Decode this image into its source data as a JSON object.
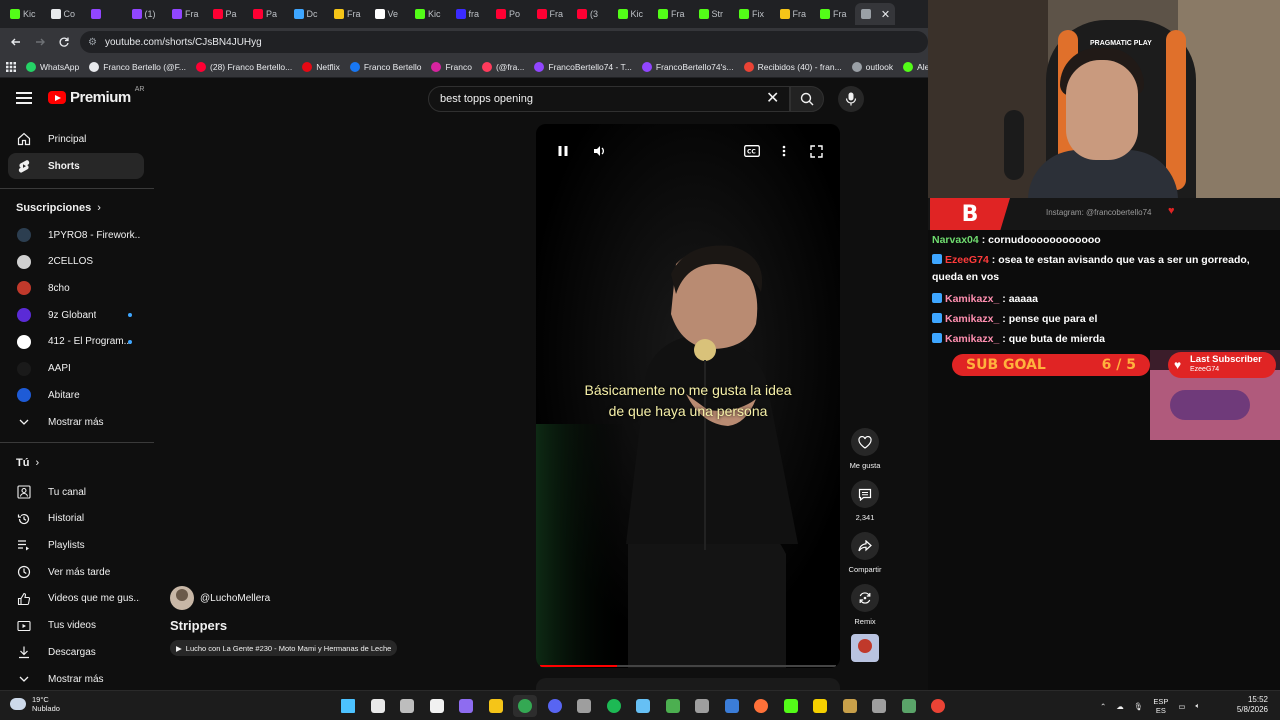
{
  "browser": {
    "tabs": [
      {
        "label": "Kic",
        "color": "#53fc18"
      },
      {
        "label": "Co",
        "color": "#e8eaed"
      },
      {
        "label": "",
        "color": "#9146ff"
      },
      {
        "label": "(1)",
        "color": "#9146ff"
      },
      {
        "label": "Fra",
        "color": "#9146ff"
      },
      {
        "label": "Pa",
        "color": "#ff0033"
      },
      {
        "label": "Pa",
        "color": "#ff0033"
      },
      {
        "label": "Dc",
        "color": "#3ea6ff"
      },
      {
        "label": "Fra",
        "color": "#f5c518"
      },
      {
        "label": "Ve",
        "color": "#ffffff"
      },
      {
        "label": "Kic",
        "color": "#53fc18"
      },
      {
        "label": "fra",
        "color": "#3b2bff"
      },
      {
        "label": "Po",
        "color": "#ff0033"
      },
      {
        "label": "Fra",
        "color": "#ff0033"
      },
      {
        "label": "(3",
        "color": "#ff0033"
      },
      {
        "label": "Kic",
        "color": "#53fc18"
      },
      {
        "label": "Fra",
        "color": "#53fc18"
      },
      {
        "label": "Str",
        "color": "#53fc18"
      },
      {
        "label": "Fix",
        "color": "#53fc18"
      },
      {
        "label": "Fra",
        "color": "#f5c518"
      },
      {
        "label": "Fra",
        "color": "#53fc18"
      },
      {
        "label": "",
        "color": "#9aa0a6"
      }
    ],
    "url": "youtube.com/shorts/CJsBN4JUHyg",
    "bookmarks": [
      {
        "label": "WhatsApp",
        "color": "#25d366"
      },
      {
        "label": "Franco Bertello (@F...",
        "color": "#e8eaed"
      },
      {
        "label": "(28) Franco Bertello...",
        "color": "#ff0033"
      },
      {
        "label": "Netflix",
        "color": "#e50914"
      },
      {
        "label": "Franco Bertello",
        "color": "#1877f2"
      },
      {
        "label": "Franco",
        "color": "#d6249f"
      },
      {
        "label": "(@fra...",
        "color": "#ff3b5c"
      },
      {
        "label": "FrancoBertello74 - T...",
        "color": "#9146ff"
      },
      {
        "label": "FrancoBertello74's...",
        "color": "#9146ff"
      },
      {
        "label": "Recibidos (40) - fran...",
        "color": "#ea4335"
      },
      {
        "label": "outlook",
        "color": "#9aa0a6"
      },
      {
        "label": "Alert",
        "color": "#53fc18"
      }
    ]
  },
  "youtube": {
    "logo_text": "Premium",
    "country_code": "AR",
    "search_query": "best topps opening",
    "sidebar": {
      "main": [
        {
          "label": "Principal",
          "icon": "home-icon"
        },
        {
          "label": "Shorts",
          "icon": "shorts-icon"
        }
      ],
      "subscriptions_header": "Suscripciones",
      "subscriptions": [
        {
          "label": "1PYRO8 - Firework...",
          "color": "#2c3e50",
          "new": false
        },
        {
          "label": "2CELLOS",
          "color": "#d0d0d0",
          "new": false
        },
        {
          "label": "8cho",
          "color": "#c0392b",
          "new": false
        },
        {
          "label": "9z Globant",
          "color": "#5b2bd6",
          "new": true
        },
        {
          "label": "412 - El Program...",
          "color": "#ffffff",
          "new": true
        },
        {
          "label": "AAPI",
          "color": "#1a1a1a",
          "new": false
        },
        {
          "label": "Abitare",
          "color": "#1e5bd6",
          "new": false
        }
      ],
      "show_more": "Mostrar más",
      "you_header": "Tú",
      "you": [
        {
          "label": "Tu canal",
          "icon": "user-icon"
        },
        {
          "label": "Historial",
          "icon": "history-icon"
        },
        {
          "label": "Playlists",
          "icon": "playlist-icon"
        },
        {
          "label": "Ver más tarde",
          "icon": "clock-icon"
        },
        {
          "label": "Videos que me gus...",
          "icon": "thumb-up-icon"
        },
        {
          "label": "Tus videos",
          "icon": "video-icon"
        },
        {
          "label": "Descargas",
          "icon": "download-icon"
        }
      ],
      "show_more_2": "Mostrar más"
    },
    "short": {
      "channel": "@LuchoMellera",
      "title": "Strippers",
      "related_link": "Lucho con La Gente #230 - Moto Mami y Hermanas de Leche",
      "subtitle_line1": "Básicamente no me gusta la idea",
      "subtitle_line2": "de que haya una persona",
      "progress": 0.26,
      "likes_label": "Me gusta",
      "comments_count": "2,341",
      "share_label": "Compartir",
      "remix_label": "Remix"
    }
  },
  "stream_overlay": {
    "chair_brand": "PRAGMATIC PLAY",
    "alert_logo": "B",
    "instagram": "Instagram: @francobertello74",
    "chat": [
      {
        "user": "Narvax04",
        "user_color": "#6fdc6f",
        "text": ": cornudoooooooooooo",
        "badge": ""
      },
      {
        "user": "EzeeG74",
        "user_color": "#ff3b3b",
        "text": ": osea te estan avisando que vas a ser un gorreado, queda en vos",
        "badge": "#3ea6ff"
      },
      {
        "user": "Kamikazx_",
        "user_color": "#ff8fb0",
        "text": ": aaaaa",
        "badge": "#3ea6ff"
      },
      {
        "user": "Kamikazx_",
        "user_color": "#ff8fb0",
        "text": ": pense que para el",
        "badge": "#3ea6ff"
      },
      {
        "user": "Kamikazx_",
        "user_color": "#ff8fb0",
        "text": ": que buta de mierda",
        "badge": "#3ea6ff"
      }
    ],
    "sub_goal_label": "SUB GOAL",
    "sub_goal_value": "6 / 5",
    "last_subscriber_label": "Last Subscriber",
    "last_subscriber_name": "EzeeG74"
  },
  "taskbar": {
    "temperature": "19°C",
    "condition": "Nublado",
    "apps": [
      {
        "name": "start-icon",
        "color": "#4cc2ff"
      },
      {
        "name": "search-icon",
        "color": "#e8e8e8"
      },
      {
        "name": "task-view-icon",
        "color": "#bdbdbd"
      },
      {
        "name": "store-icon",
        "color": "#f1f1f1"
      },
      {
        "name": "app-icon",
        "color": "#8e6cf0"
      },
      {
        "name": "explorer-icon",
        "color": "#f5c518"
      },
      {
        "name": "chrome-icon",
        "color": "#34a853"
      },
      {
        "name": "discord-icon",
        "color": "#5865f2"
      },
      {
        "name": "obs-icon",
        "color": "#9e9e9e"
      },
      {
        "name": "spotify-icon",
        "color": "#1db954"
      },
      {
        "name": "steam-icon",
        "color": "#66c0f4"
      },
      {
        "name": "app-icon",
        "color": "#4caf50"
      },
      {
        "name": "app-icon",
        "color": "#9e9e9e"
      },
      {
        "name": "app-icon",
        "color": "#3b7dd8"
      },
      {
        "name": "firefox-icon",
        "color": "#ff7139"
      },
      {
        "name": "terminal-icon",
        "color": "#53fc18"
      },
      {
        "name": "notes-icon",
        "color": "#f5d000"
      },
      {
        "name": "app-icon",
        "color": "#c8a04a"
      },
      {
        "name": "calculator-icon",
        "color": "#9e9e9e"
      },
      {
        "name": "app-icon",
        "color": "#5aa469"
      },
      {
        "name": "chrome-icon",
        "color": "#ea4335"
      }
    ],
    "lang_top": "ESP",
    "lang_bottom": "ES",
    "time": "15:52",
    "date": "5/8/2026"
  }
}
